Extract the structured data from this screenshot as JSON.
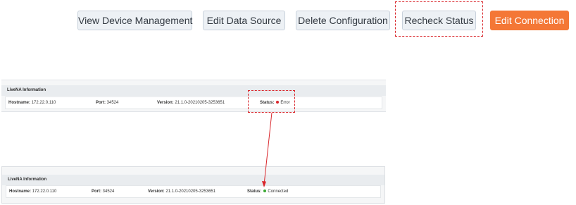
{
  "toolbar": {
    "view_device_management": "View Device Management",
    "edit_data_source": "Edit Data Source",
    "delete_configuration": "Delete Configuration",
    "recheck_status": "Recheck Status",
    "edit_connection": "Edit Connection"
  },
  "panel_before": {
    "title": "LiveNA Information",
    "hostname_label": "Hostname:",
    "hostname_value": "172.22.0.110",
    "port_label": "Port:",
    "port_value": "34524",
    "version_label": "Version:",
    "version_value": "21.1.0-20210205-3253651",
    "status_label": "Status:",
    "status_value": "Error",
    "status_color": "#d9262b"
  },
  "panel_after": {
    "title": "LiveNA Information",
    "hostname_label": "Hostname:",
    "hostname_value": "172.22.0.110",
    "port_label": "Port:",
    "port_value": "34524",
    "version_label": "Version:",
    "version_value": "21.1.0-20210205-3253651",
    "status_label": "Status:",
    "status_value": "Connected",
    "status_color": "#3aa935"
  },
  "colors": {
    "primary_button": "#f47736",
    "highlight": "#d9262b"
  }
}
